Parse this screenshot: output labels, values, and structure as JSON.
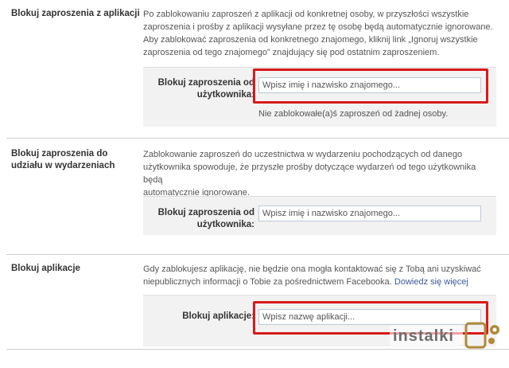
{
  "sections": [
    {
      "title": "Blokuj zaproszenia z aplikacji",
      "desc": [
        "Po zablokowaniu zaproszeń z aplikacji od konkretnej osoby, w przyszłości wszystkie",
        "zaproszenia i prośby z aplikacji wysyłane przez tę osobę będą automatycznie ignorowane.",
        "Aby zablokować zaproszenia od konkretnego znajomego, kliknij link „Ignoruj wszystkie",
        "zaproszenia od tego znajomego” znajdujący się pod ostatnim zaproszeniem."
      ],
      "label": [
        "Blokuj zaproszenia od",
        "użytkownika:"
      ],
      "placeholder": "Wpisz imię i nazwisko znajomego...",
      "note": "Nie zablokowałe(a)ś zaproszeń od żadnej osoby."
    },
    {
      "title": [
        "Blokuj zaproszenia do",
        "udziału w wydarzeniach"
      ],
      "desc": [
        "Zablokowanie zaproszeń do uczestnictwa w wydarzeniu pochodzących od danego",
        "użytkownika spowoduje, że przyszłe prośby dotyczące wydarzeń od tego użytkownika będą",
        "automatycznie ignorowane."
      ],
      "label": [
        "Blokuj zaproszenia od",
        "użytkownika:"
      ],
      "placeholder": "Wpisz imię i nazwisko znajomego..."
    },
    {
      "title": "Blokuj aplikacje",
      "desc": [
        "Gdy zablokujesz aplikację, nie będzie ona mogła kontaktować się z Tobą ani uzyskiwać",
        "niepublicznych informacji o Tobie za pośrednictwem Facebooka."
      ],
      "learn_more": "Dowiedz się więcej",
      "label": "Blokuj aplikacje:",
      "placeholder": "Wpisz nazwę aplikacji..."
    }
  ],
  "watermark": "instalki",
  "colors": {
    "highlight": "#d91a1a",
    "link": "#3b5998",
    "box_bg": "#f2f2f2"
  }
}
